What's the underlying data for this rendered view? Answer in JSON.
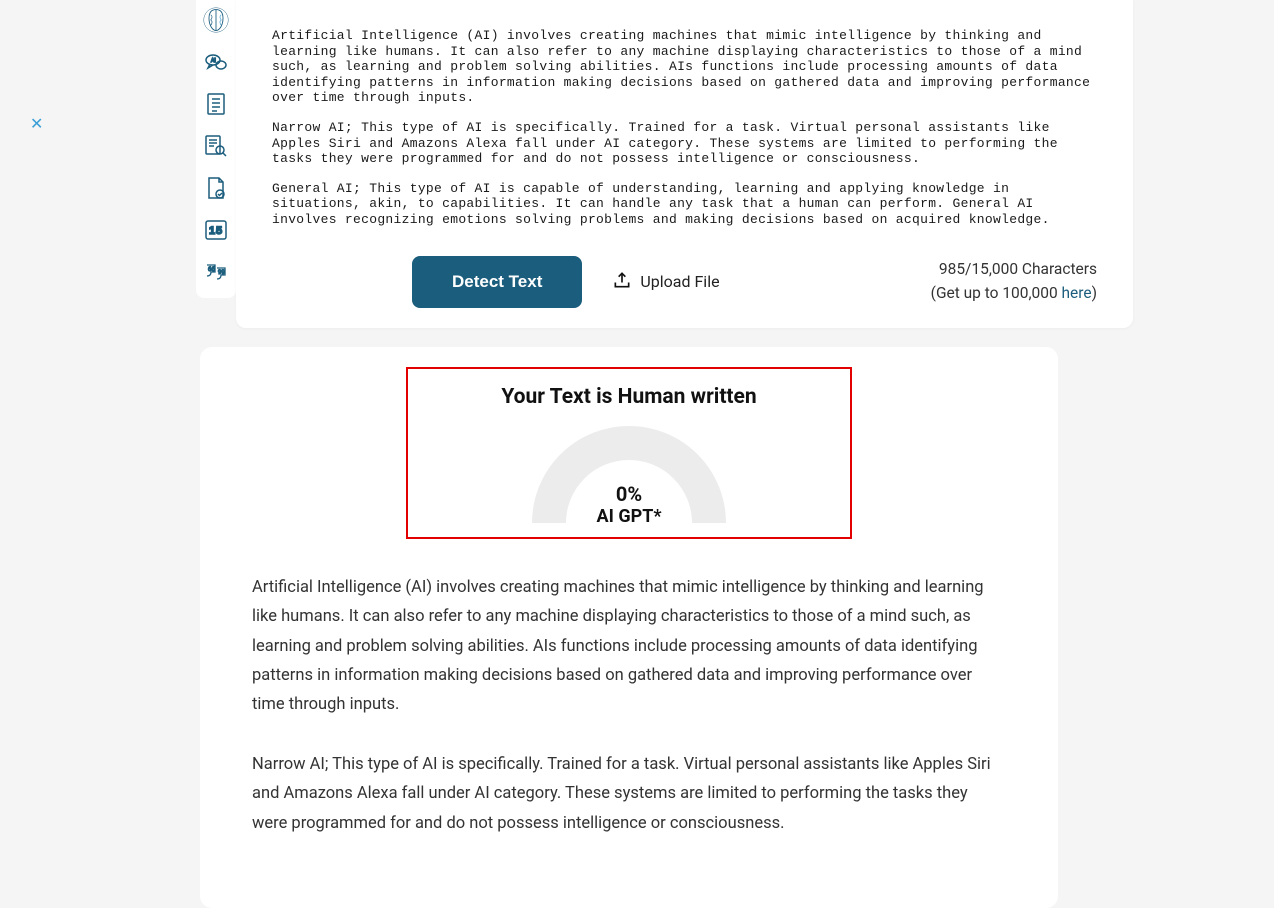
{
  "close_label": "✕",
  "sidebar": {
    "items": [
      {
        "name": "brain-icon"
      },
      {
        "name": "ai-chat-icon"
      },
      {
        "name": "document-list-icon"
      },
      {
        "name": "document-search-icon"
      },
      {
        "name": "document-check-icon"
      },
      {
        "name": "digits-icon"
      },
      {
        "name": "quote-icon"
      }
    ]
  },
  "input": {
    "p1": "Artificial Intelligence (AI) involves creating machines that mimic intelligence by thinking and learning like humans. It can also refer to any machine displaying characteristics to those of a mind such, as learning and problem solving abilities. AIs functions include processing amounts of data identifying patterns in information making decisions based on gathered data and improving performance over time through inputs.",
    "p2": "Narrow AI; This type of AI is specifically. Trained for a task. Virtual personal assistants like Apples Siri and Amazons Alexa fall under AI category. These systems are limited to performing the tasks they were programmed for and do not possess intelligence or consciousness.",
    "p3": "General AI; This type of AI is capable of understanding, learning and applying knowledge in situations, akin, to capabilities. It can handle any task that a human can perform. General AI involves recognizing emotions solving problems and making decisions based on acquired knowledge."
  },
  "actions": {
    "detect_label": "Detect Text",
    "upload_label": "Upload File"
  },
  "char_counter": {
    "count_text": "985/15,000 Characters",
    "upsell_prefix": "(Get up to 100,000 ",
    "here_label": "here",
    "upsell_suffix": ")"
  },
  "result": {
    "title": "Your Text is Human written",
    "percent": "0%",
    "sublabel": "AI GPT*",
    "p1": "Artificial Intelligence (AI) involves creating machines that mimic intelligence by thinking and learning like humans. It can also refer to any machine displaying characteristics to those of a mind such, as learning and problem solving abilities. AIs functions include processing amounts of data identifying patterns in information making decisions based on gathered data and improving performance over time through inputs.",
    "p2": "Narrow AI; This type of AI is specifically. Trained for a task. Virtual personal assistants like Apples Siri and Amazons Alexa fall under AI category. These systems are limited to performing the tasks they were programmed for and do not possess intelligence or consciousness."
  },
  "chart_data": {
    "type": "gauge",
    "value": 0,
    "min": 0,
    "max": 100,
    "label": "AI GPT*",
    "title": "Your Text is Human written"
  }
}
